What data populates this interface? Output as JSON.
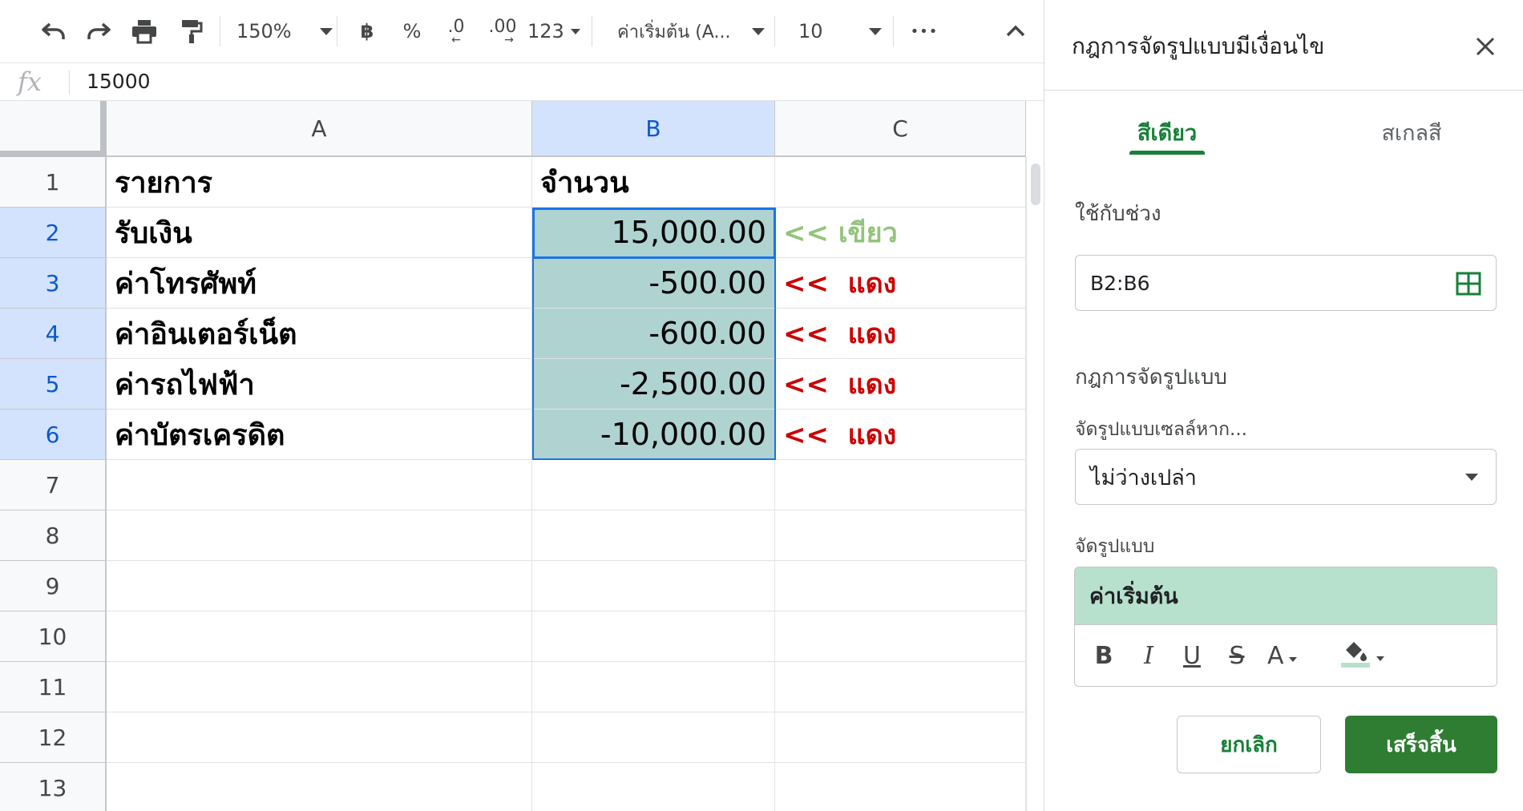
{
  "toolbar": {
    "zoom": "150%",
    "currency": "฿",
    "percent": "%",
    "decrease_decimal": ".0",
    "increase_decimal": ".00",
    "number_format": "123",
    "font": "ค่าเริ่มต้น (A...",
    "font_size": "10",
    "more": "•••"
  },
  "formula_bar": {
    "fx": "fx",
    "value": "15000"
  },
  "columns": [
    "A",
    "B",
    "C"
  ],
  "rows": [
    "1",
    "2",
    "3",
    "4",
    "5",
    "6",
    "7",
    "8",
    "9",
    "10",
    "11",
    "12",
    "13"
  ],
  "cells": {
    "r1": {
      "a": "รายการ",
      "b": "จำนวน",
      "c": ""
    },
    "r2": {
      "a": "รับเงิน",
      "b": "15,000.00",
      "c": "<< เขียว"
    },
    "r3": {
      "a": "ค่าโทรศัพท์",
      "b": "-500.00",
      "c": "<<  แดง"
    },
    "r4": {
      "a": "ค่าอินเตอร์เน็ต",
      "b": "-600.00",
      "c": "<<  แดง"
    },
    "r5": {
      "a": "ค่ารถไฟฟ้า",
      "b": "-2,500.00",
      "c": "<<  แดง"
    },
    "r6": {
      "a": "ค่าบัตรเครดิต",
      "b": "-10,000.00",
      "c": "<<  แดง"
    }
  },
  "colors": {
    "fill": "#afd3d0",
    "green_text": "#93c47d",
    "red_text": "#cc0000",
    "accent": "#188038",
    "done_button": "#2e7d32",
    "preview_fill": "#b7e1cd"
  },
  "panel": {
    "title": "กฎการจัดรูปแบบมีเงื่อนไข",
    "tabs": {
      "single_color": "สีเดียว",
      "color_scale": "สเกลสี"
    },
    "apply_to_label": "ใช้กับช่วง",
    "range": "B2:B6",
    "rules_label": "กฎการจัดรูปแบบ",
    "format_if_label": "จัดรูปแบบเซลล์หาก...",
    "condition": "ไม่ว่างเปล่า",
    "format_label": "จัดรูปแบบ",
    "preview_text": "ค่าเริ่มต้น",
    "style_tools": {
      "bold": "B",
      "italic": "I",
      "underline": "U",
      "strike": "S",
      "text_color": "A"
    },
    "cancel": "ยกเลิก",
    "done": "เสร็จสิ้น"
  }
}
